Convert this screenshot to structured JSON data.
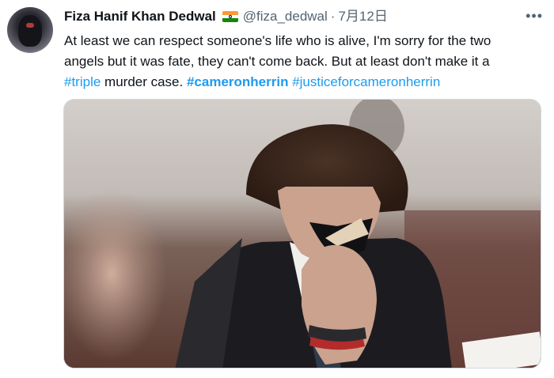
{
  "tweet": {
    "author_name": "Fiza Hanif Khan Dedwal",
    "flag_icon": "india-flag-icon",
    "handle": "@fiza_dedwal",
    "separator": "·",
    "date": "7月12日",
    "more_icon": "more-options-icon",
    "more_label": "•••",
    "text_line1": "At least we can respect someone's life who is alive, I'm sorry for the two",
    "text_line2": "angels but it was fate, they can't come back. But at least don't make it a",
    "hashtag_triple": "#triple",
    "text_middle": " murder case. ",
    "hashtag_cameronherrin": "#cameronherrin",
    "hashtag_justice": "#justiceforcameronherrin",
    "colors": {
      "link": "#1d9bf0",
      "text": "#0f1419",
      "secondary": "#536471"
    }
  }
}
